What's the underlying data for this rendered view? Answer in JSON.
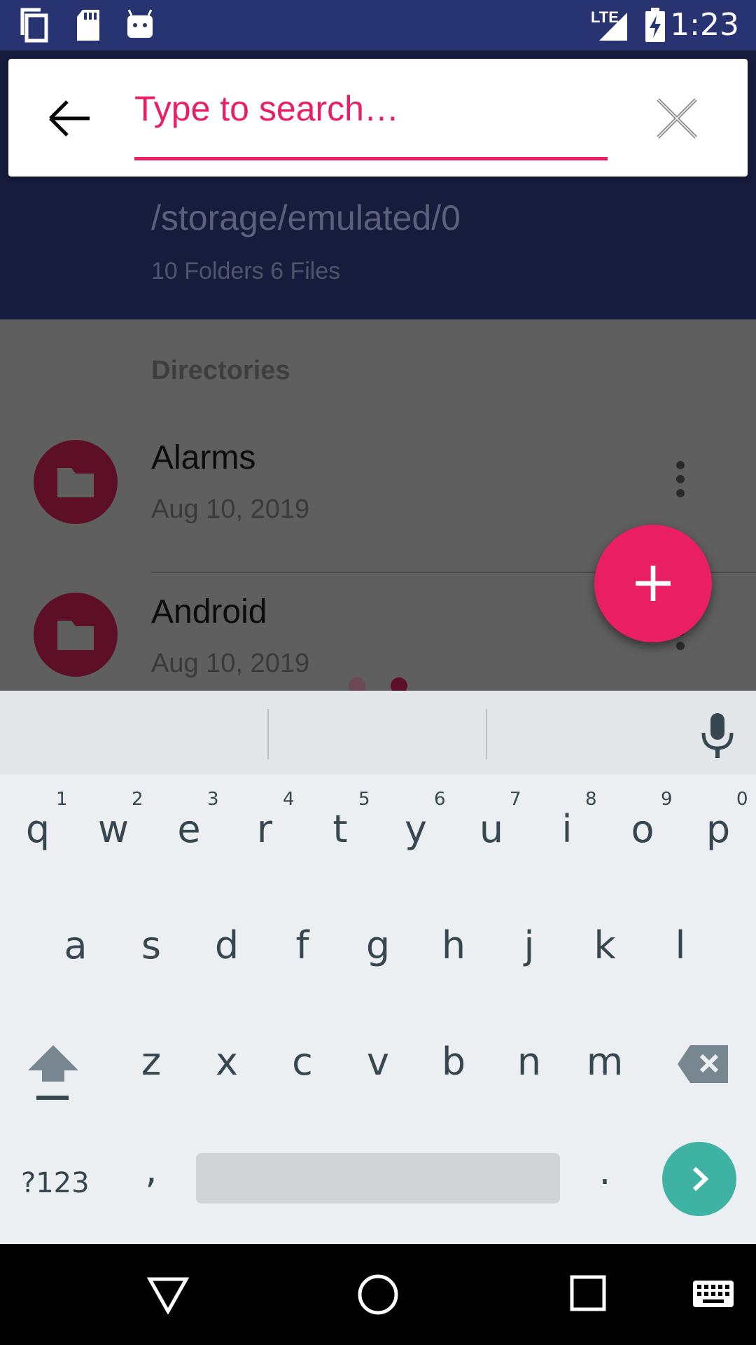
{
  "status_bar": {
    "time": "1:23",
    "network": "LTE",
    "icons": [
      "copy-icon",
      "sd-card-icon",
      "android-icon",
      "lte-signal-icon",
      "battery-charging-icon"
    ]
  },
  "header": {
    "path": "/storage/emulated/0",
    "summary": "10 Folders 6 Files"
  },
  "search": {
    "placeholder": "Type to search…",
    "value": "",
    "back_icon": "arrow-back-icon",
    "clear_icon": "close-icon",
    "accent_color": "#e91e63"
  },
  "list": {
    "section_title": "Directories",
    "items": [
      {
        "name": "Alarms",
        "date": "Aug 10, 2019",
        "icon": "folder-icon"
      },
      {
        "name": "Android",
        "date": "Aug 10, 2019",
        "icon": "folder-icon"
      }
    ]
  },
  "fab": {
    "label": "+",
    "icon": "add-icon",
    "color": "#e91e63"
  },
  "keyboard": {
    "row1": [
      {
        "key": "q",
        "hint": "1"
      },
      {
        "key": "w",
        "hint": "2"
      },
      {
        "key": "e",
        "hint": "3"
      },
      {
        "key": "r",
        "hint": "4"
      },
      {
        "key": "t",
        "hint": "5"
      },
      {
        "key": "y",
        "hint": "6"
      },
      {
        "key": "u",
        "hint": "7"
      },
      {
        "key": "i",
        "hint": "8"
      },
      {
        "key": "o",
        "hint": "9"
      },
      {
        "key": "p",
        "hint": "0"
      }
    ],
    "row2": [
      "a",
      "s",
      "d",
      "f",
      "g",
      "h",
      "j",
      "k",
      "l"
    ],
    "row3": [
      "z",
      "x",
      "c",
      "v",
      "b",
      "n",
      "m"
    ],
    "symbols_label": "?123",
    "comma": ",",
    "period": ".",
    "enter_color": "#3fb3a3"
  },
  "nav_bar": {
    "icons": [
      "back-triangle-icon",
      "home-circle-icon",
      "recents-square-icon",
      "keyboard-icon"
    ]
  }
}
